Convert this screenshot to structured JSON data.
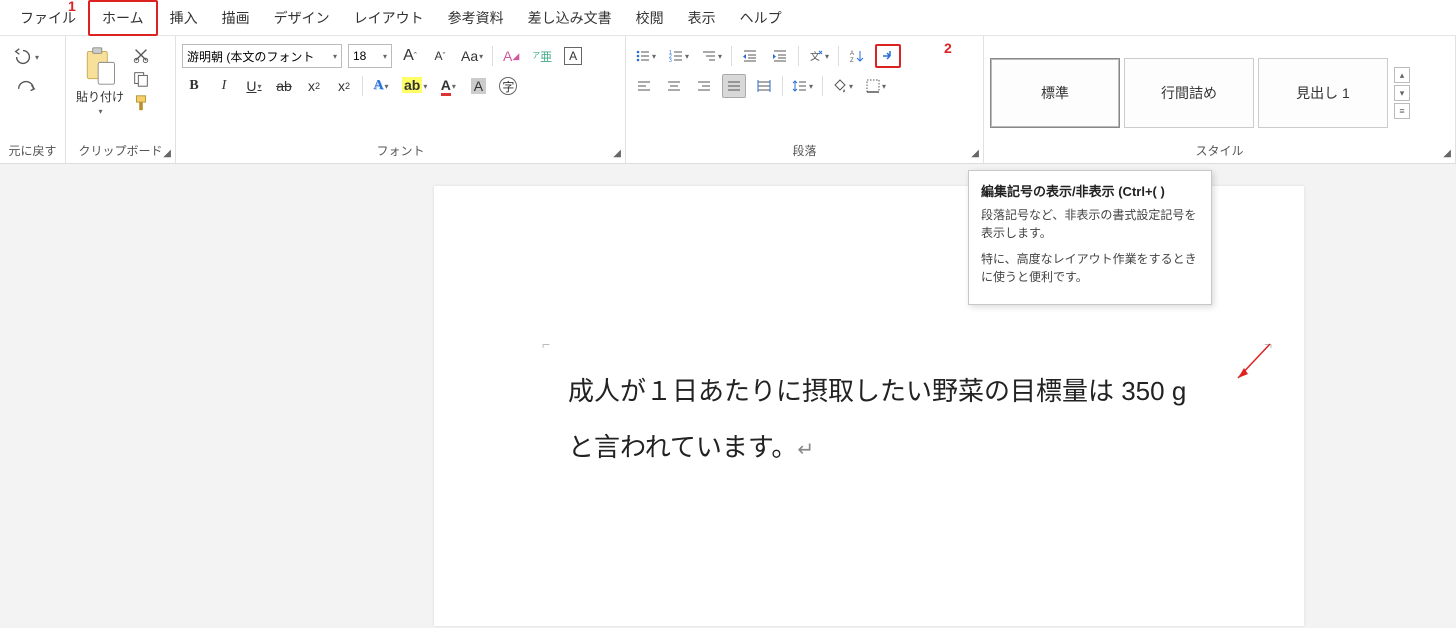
{
  "menu": {
    "items": [
      "ファイル",
      "ホーム",
      "挿入",
      "描画",
      "デザイン",
      "レイアウト",
      "参考資料",
      "差し込み文書",
      "校閲",
      "表示",
      "ヘルプ"
    ],
    "active_index": 1
  },
  "annotations": {
    "n1": "1",
    "n2": "2"
  },
  "ribbon": {
    "undo": {
      "label": "元に戻す"
    },
    "clipboard": {
      "label": "クリップボード",
      "paste": "貼り付け"
    },
    "font": {
      "label": "フォント",
      "font_name": "游明朝 (本文のフォント",
      "font_size": "18",
      "grow": "A",
      "shrink": "A",
      "case": "Aa",
      "ruby": "ア",
      "charborder": "A",
      "bold": "B",
      "italic": "I",
      "underline": "U",
      "strike": "ab",
      "sub_base": "x",
      "sub": "2",
      "sup_base": "x",
      "sup": "2",
      "texteffect": "A",
      "highlight": "ab",
      "fontcolor": "A",
      "charshade": "A",
      "enclosed": "字"
    },
    "paragraph": {
      "label": "段落",
      "sort": "A↓Z"
    },
    "styles": {
      "label": "スタイル",
      "items": [
        "標準",
        "行間詰め",
        "見出し 1"
      ]
    }
  },
  "tooltip": {
    "title": "編集記号の表示/非表示 (Ctrl+( )",
    "p1": "段落記号など、非表示の書式設定記号を表示します。",
    "p2": "特に、高度なレイアウト作業をするときに使うと便利です。"
  },
  "document": {
    "line1": "成人が１日あたりに摂取したい野菜の目標量は 350 g",
    "line2": "と言われています。",
    "para_mark": "↵"
  }
}
